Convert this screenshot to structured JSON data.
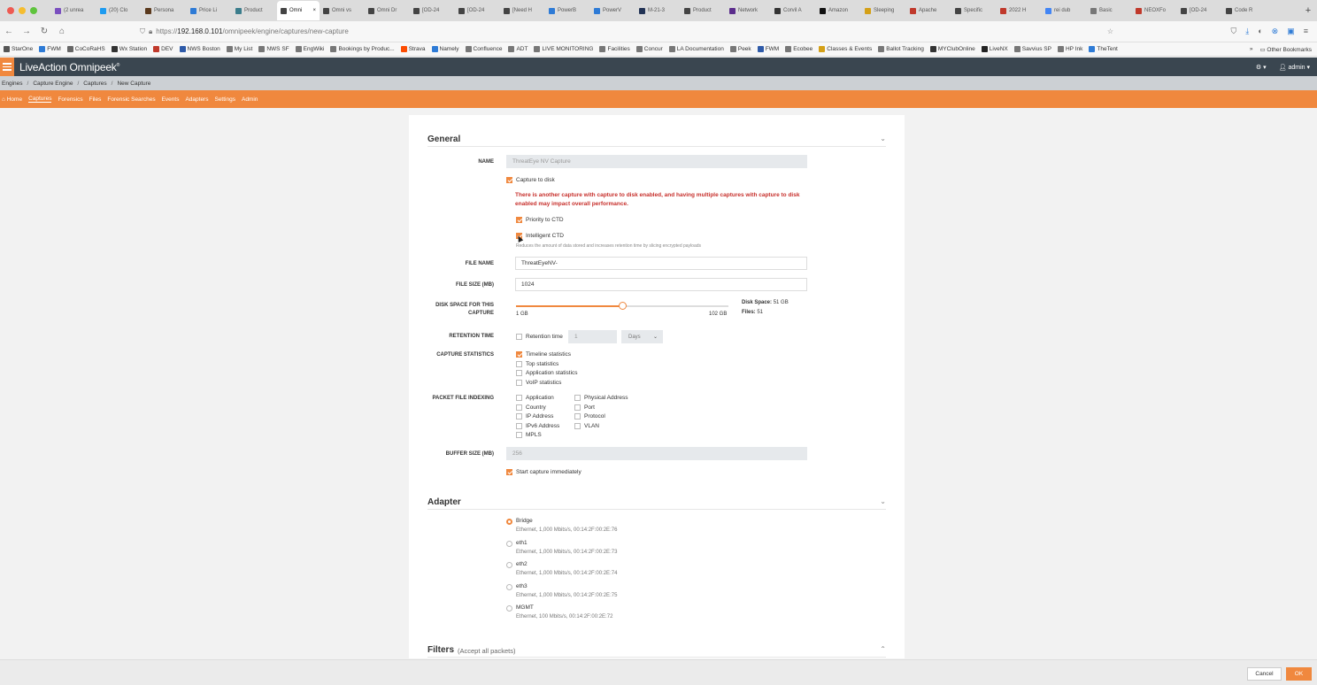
{
  "browser": {
    "tabs": [
      {
        "label": "(2 unrea",
        "color": "#7a4fbf"
      },
      {
        "label": "(20) Clo",
        "color": "#1d9bf0"
      },
      {
        "label": "Persona",
        "color": "#5b3a1e"
      },
      {
        "label": "Price Li",
        "color": "#2e7bd6"
      },
      {
        "label": "Product",
        "color": "#3b7d8c"
      },
      {
        "label": "Omni",
        "color": "#444444",
        "active": true
      },
      {
        "label": "Omni vs",
        "color": "#444444"
      },
      {
        "label": "Omni Dr",
        "color": "#444444"
      },
      {
        "label": "[OD-24",
        "color": "#444444"
      },
      {
        "label": "[OD-24",
        "color": "#444444"
      },
      {
        "label": "[Need H",
        "color": "#444444"
      },
      {
        "label": "PowerB",
        "color": "#2e7bd6"
      },
      {
        "label": "PowerV",
        "color": "#2e7bd6"
      },
      {
        "label": "M-21-3",
        "color": "#223355"
      },
      {
        "label": "Product",
        "color": "#444444"
      },
      {
        "label": "Network",
        "color": "#5b2d8c"
      },
      {
        "label": "Corvil A",
        "color": "#333333"
      },
      {
        "label": "Amazon",
        "color": "#111111"
      },
      {
        "label": "Sleeping",
        "color": "#d4a017"
      },
      {
        "label": "Apache",
        "color": "#c0392b"
      },
      {
        "label": "Specific",
        "color": "#444444"
      },
      {
        "label": "2022 H",
        "color": "#c0392b"
      },
      {
        "label": "rei dub",
        "color": "#4285f4"
      },
      {
        "label": "Basic",
        "color": "#777777"
      },
      {
        "label": "NEOXFo",
        "color": "#c0392b"
      },
      {
        "label": "[OD-24",
        "color": "#444444"
      },
      {
        "label": "Code R",
        "color": "#444444"
      }
    ],
    "new_tab": "+",
    "url_scheme": "https://",
    "url_host": "192.168.0.101",
    "url_path": "/omnipeek/engine/captures/new-capture",
    "bookmarks": [
      {
        "label": "StarOne",
        "color": "#555555"
      },
      {
        "label": "FWM",
        "color": "#2e7bd6"
      },
      {
        "label": "CoCoRaHS",
        "color": "#666666"
      },
      {
        "label": "Wx Station",
        "color": "#333333"
      },
      {
        "label": "DEV",
        "color": "#c0392b"
      },
      {
        "label": "NWS Boston",
        "color": "#2e5aa8"
      },
      {
        "label": "My List",
        "color": "#777777"
      },
      {
        "label": "NWS SF",
        "color": "#777777"
      },
      {
        "label": "EngWiki",
        "color": "#777777"
      },
      {
        "label": "Bookings by Produc...",
        "color": "#777777"
      },
      {
        "label": "Strava",
        "color": "#fc4c02"
      },
      {
        "label": "Namely",
        "color": "#2e7bd6"
      },
      {
        "label": "Confluence",
        "color": "#777777"
      },
      {
        "label": "ADT",
        "color": "#777777"
      },
      {
        "label": "LIVE MONITORING",
        "color": "#777777"
      },
      {
        "label": "Facilities",
        "color": "#777777"
      },
      {
        "label": "Concur",
        "color": "#777777"
      },
      {
        "label": "LA Documentation",
        "color": "#777777"
      },
      {
        "label": "Peek",
        "color": "#777777"
      },
      {
        "label": "FWM",
        "color": "#2e5aa8"
      },
      {
        "label": "Ecobee",
        "color": "#777777"
      },
      {
        "label": "Classes & Events",
        "color": "#d4a017"
      },
      {
        "label": "Ballot Tracking",
        "color": "#777777"
      },
      {
        "label": "MYClubOnline",
        "color": "#333333"
      },
      {
        "label": "LiveNX",
        "color": "#222222"
      },
      {
        "label": "Savvius SP",
        "color": "#777777"
      },
      {
        "label": "HP Ink",
        "color": "#777777"
      },
      {
        "label": "TheTent",
        "color": "#2e7bd6"
      }
    ],
    "other_bookmarks": "Other Bookmarks"
  },
  "app": {
    "brand_main": "LiveAction",
    "brand_product": " Omnipeek",
    "brand_mark": "®",
    "user": "admin",
    "breadcrumb": [
      "Engines",
      "Capture Engine",
      "Captures",
      "New Capture"
    ],
    "menu": [
      "Home",
      "Captures",
      "Forensics",
      "Files",
      "Forensic Searches",
      "Events",
      "Adapters",
      "Settings",
      "Admin"
    ],
    "menu_active": "Captures"
  },
  "general": {
    "title": "General",
    "name_label": "NAME",
    "name_value": "ThreatEye NV Capture",
    "capture_to_disk": "Capture to disk",
    "warning": "There is another capture with capture to disk enabled, and having multiple captures with capture to disk enabled may impact overall performance.",
    "priority_ctd": "Priority to CTD",
    "intelligent_ctd": "Intelligent CTD",
    "intelligent_hint": "Reduces the amount of data stored and increases retention time by slicing encrypted payloads",
    "file_name_label": "FILE NAME",
    "file_name_value": "ThreatEyeNV-",
    "file_size_label": "FILE SIZE (MB)",
    "file_size_value": "1024",
    "disk_space_label": "DISK SPACE FOR THIS CAPTURE",
    "slider_min": "1 GB",
    "slider_max": "102 GB",
    "slider_fraction": 0.5,
    "disk_space_key": "Disk Space:",
    "disk_space_value": " 51 GB",
    "files_key": "Files:",
    "files_value": " 51",
    "retention_label": "RETENTION TIME",
    "retention_cb": "Retention time",
    "retention_value": "1",
    "retention_unit": "Days",
    "stats_label": "CAPTURE STATISTICS",
    "stats": [
      {
        "label": "Timeline statistics",
        "on": true
      },
      {
        "label": "Top statistics",
        "on": false
      },
      {
        "label": "Application statistics",
        "on": false
      },
      {
        "label": "VoIP statistics",
        "on": false
      }
    ],
    "indexing_label": "PACKET FILE INDEXING",
    "indexing_left": [
      "Application",
      "Country",
      "IP Address",
      "IPv6 Address",
      "MPLS"
    ],
    "indexing_right": [
      "Physical Address",
      "Port",
      "Protocol",
      "VLAN"
    ],
    "buffer_label": "BUFFER SIZE (MB)",
    "buffer_value": "256",
    "start_immediately": "Start capture immediately"
  },
  "adapter": {
    "title": "Adapter",
    "items": [
      {
        "name": "Bridge",
        "desc": "Ethernet, 1,000 Mbits/s, 00:14:2F:00:2E:76",
        "on": true
      },
      {
        "name": "eth1",
        "desc": "Ethernet, 1,000 Mbits/s, 00:14:2F:00:2E:73",
        "on": false
      },
      {
        "name": "eth2",
        "desc": "Ethernet, 1,000 Mbits/s, 00:14:2F:00:2E:74",
        "on": false
      },
      {
        "name": "eth3",
        "desc": "Ethernet, 1,000 Mbits/s, 00:14:2F:00:2E:75",
        "on": false
      },
      {
        "name": "MGMT",
        "desc": "Ethernet, 100 Mbits/s, 00:14:2F:00:2E:72",
        "on": false
      }
    ]
  },
  "filters": {
    "title": "Filters",
    "subtitle": "(Accept all packets)"
  },
  "footer": {
    "cancel": "Cancel",
    "ok": "OK"
  }
}
